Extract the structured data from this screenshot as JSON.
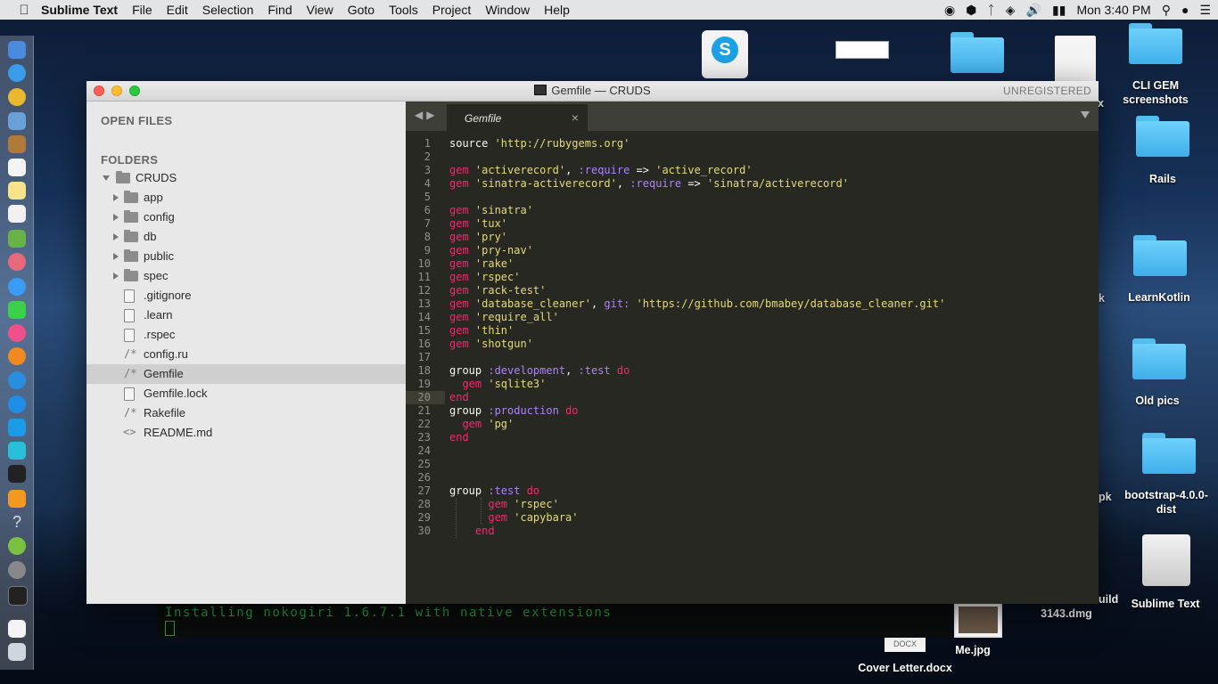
{
  "menubar": {
    "app_name": "Sublime Text",
    "items": [
      "File",
      "Edit",
      "Selection",
      "Find",
      "View",
      "Goto",
      "Tools",
      "Project",
      "Window",
      "Help"
    ],
    "clock": "Mon 3:40 PM"
  },
  "desktop": {
    "items": [
      {
        "label": "CLI GEM\nscreenshots"
      },
      {
        "label": "Rails"
      },
      {
        "label": "LearnKotlin"
      },
      {
        "label": "Old pics"
      },
      {
        "label": "bootstrap-4.0.0-\ndist"
      },
      {
        "label": "Sublime Text"
      },
      {
        "label": "3143.dmg"
      },
      {
        "label": "Me.jpg"
      },
      {
        "label": "Cover Letter.docx"
      }
    ],
    "partial_labels": [
      "cx",
      "k",
      "pk",
      "uild"
    ],
    "docx_tag": "DOCX"
  },
  "terminal": {
    "line": "Installing nokogiri 1.6.7.1 with native extensions"
  },
  "window": {
    "title": "Gemfile — CRUDS",
    "unregistered": "UNREGISTERED"
  },
  "sidebar": {
    "open_files_header": "OPEN FILES",
    "folders_header": "FOLDERS",
    "root": "CRUDS",
    "folders": [
      "app",
      "config",
      "db",
      "public",
      "spec"
    ],
    "files": [
      {
        "name": ".gitignore",
        "icon": "file-icon"
      },
      {
        "name": ".learn",
        "icon": "file-icon"
      },
      {
        "name": ".rspec",
        "icon": "file-icon"
      },
      {
        "name": "config.ru",
        "icon": "/*"
      },
      {
        "name": "Gemfile",
        "icon": "/*",
        "selected": true
      },
      {
        "name": "Gemfile.lock",
        "icon": "file-icon"
      },
      {
        "name": "Rakefile",
        "icon": "/*"
      },
      {
        "name": "README.md",
        "icon": "<>"
      }
    ]
  },
  "editor": {
    "tab": "Gemfile",
    "current_line": 20,
    "lines": [
      [
        [
          "source ",
          "p"
        ],
        [
          "'http://rubygems.org'",
          "s"
        ]
      ],
      [],
      [
        [
          "gem ",
          "k"
        ],
        [
          "'activerecord'",
          "s"
        ],
        [
          ", ",
          "p"
        ],
        [
          ":require",
          "sy"
        ],
        [
          " => ",
          "p"
        ],
        [
          "'active_record'",
          "s"
        ]
      ],
      [
        [
          "gem ",
          "k"
        ],
        [
          "'sinatra-activerecord'",
          "s"
        ],
        [
          ", ",
          "p"
        ],
        [
          ":require",
          "sy"
        ],
        [
          " => ",
          "p"
        ],
        [
          "'sinatra/activerecord'",
          "s"
        ]
      ],
      [],
      [
        [
          "gem ",
          "k"
        ],
        [
          "'sinatra'",
          "s"
        ]
      ],
      [
        [
          "gem ",
          "k"
        ],
        [
          "'tux'",
          "s"
        ]
      ],
      [
        [
          "gem ",
          "k"
        ],
        [
          "'pry'",
          "s"
        ]
      ],
      [
        [
          "gem ",
          "k"
        ],
        [
          "'pry-nav'",
          "s"
        ]
      ],
      [
        [
          "gem ",
          "k"
        ],
        [
          "'rake'",
          "s"
        ]
      ],
      [
        [
          "gem ",
          "k"
        ],
        [
          "'rspec'",
          "s"
        ]
      ],
      [
        [
          "gem ",
          "k"
        ],
        [
          "'rack-test'",
          "s"
        ]
      ],
      [
        [
          "gem ",
          "k"
        ],
        [
          "'database_cleaner'",
          "s"
        ],
        [
          ", ",
          "p"
        ],
        [
          "git:",
          "sy"
        ],
        [
          " ",
          "p"
        ],
        [
          "'https://github.com/bmabey/database_cleaner.git'",
          "s"
        ]
      ],
      [
        [
          "gem ",
          "k"
        ],
        [
          "'require_all'",
          "s"
        ]
      ],
      [
        [
          "gem ",
          "k"
        ],
        [
          "'thin'",
          "s"
        ]
      ],
      [
        [
          "gem ",
          "k"
        ],
        [
          "'shotgun'",
          "s"
        ]
      ],
      [],
      [
        [
          "group ",
          "p"
        ],
        [
          ":development",
          "sy"
        ],
        [
          ", ",
          "p"
        ],
        [
          ":test",
          "sy"
        ],
        [
          " do",
          "k"
        ]
      ],
      [
        [
          "  gem ",
          "k"
        ],
        [
          "'sqlite3'",
          "s"
        ]
      ],
      [
        [
          "end",
          "k"
        ]
      ],
      [
        [
          "group ",
          "p"
        ],
        [
          ":production",
          "sy"
        ],
        [
          " do",
          "k"
        ]
      ],
      [
        [
          "  gem ",
          "k"
        ],
        [
          "'pg'",
          "s"
        ]
      ],
      [
        [
          "end",
          "k"
        ]
      ],
      [],
      [],
      [],
      [
        [
          "group ",
          "p"
        ],
        [
          ":test",
          "sy"
        ],
        [
          " do",
          "k"
        ]
      ],
      [
        [
          "      gem ",
          "k"
        ],
        [
          "'rspec'",
          "s"
        ]
      ],
      [
        [
          "      gem ",
          "k"
        ],
        [
          "'capybara'",
          "s"
        ]
      ],
      [
        [
          "    end",
          "k"
        ]
      ]
    ]
  }
}
